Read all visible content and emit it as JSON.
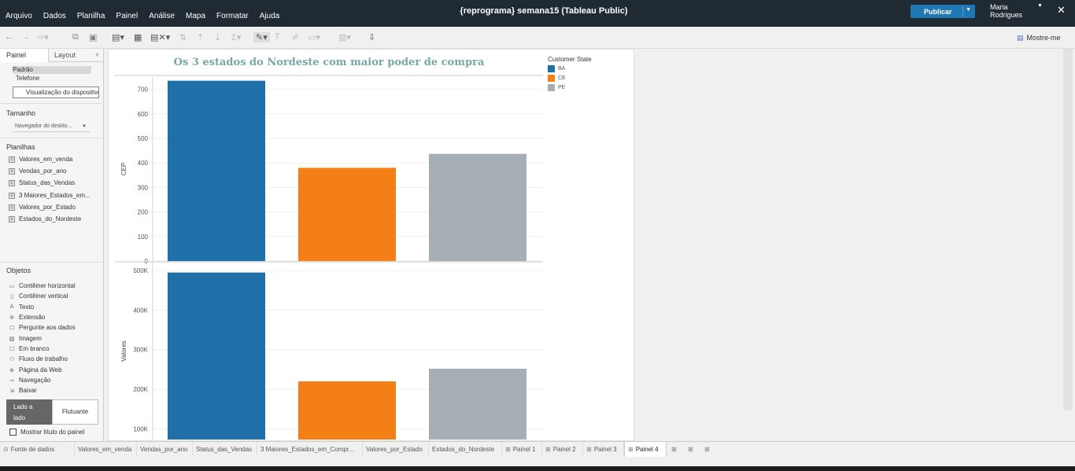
{
  "menu": [
    "Arquivo",
    "Dados",
    "Planilha",
    "Painel",
    "Análise",
    "Mapa",
    "Formatar",
    "Ajuda"
  ],
  "window_title": "{reprograma} semana15 (Tableau Public)",
  "publish_label": "Publicar",
  "user_name": "Maria Rodrigues",
  "toolbar": {
    "show_me": "Mostre-me"
  },
  "left_panel": {
    "tab_painel": "Painel",
    "tab_layout": "Layout",
    "devices": [
      "Padrão",
      "Telefone"
    ],
    "preview_button": "Visualização do dispositivo",
    "size_title": "Tamanho",
    "size_value": "Navegador do deskto...",
    "sheets_title": "Planilhas",
    "sheets": [
      "Valores_em_venda",
      "Vendas_por_ano",
      "Status_das_Vendas",
      "3 Maiores_Estados_em...",
      "Valores_por_Estado",
      "Estados_do_Nordeste"
    ],
    "objects_title": "Objetos",
    "objects": [
      {
        "label": "Contêiner horizontal",
        "icon": "horizontal-container-icon"
      },
      {
        "label": "Contêiner vertical",
        "icon": "vertical-container-icon"
      },
      {
        "label": "Texto",
        "icon": "text-icon"
      },
      {
        "label": "Extensão",
        "icon": "extension-icon"
      },
      {
        "label": "Pergunte aos dados",
        "icon": "ask-data-icon"
      },
      {
        "label": "Imagem",
        "icon": "image-icon"
      },
      {
        "label": "Em branco",
        "icon": "blank-icon"
      },
      {
        "label": "Fluxo de trabalho",
        "icon": "workflow-icon"
      },
      {
        "label": "Página da Web",
        "icon": "web-page-icon"
      },
      {
        "label": "Navegação",
        "icon": "navigation-icon"
      },
      {
        "label": "Baixar",
        "icon": "download-icon"
      }
    ],
    "btn_lado": "Lado a lado",
    "btn_flutuante": "Flutuante",
    "show_title_label": "Mostrar título do painel"
  },
  "bottom_tabs": [
    {
      "label": "Fonte de dados",
      "kind": "datasource"
    },
    {
      "label": "Valores_em_venda",
      "kind": "sheet"
    },
    {
      "label": "Vendas_por_ano",
      "kind": "sheet"
    },
    {
      "label": "Status_das_Vendas",
      "kind": "sheet"
    },
    {
      "label": "3 Maiores_Estados_em_Compr...",
      "kind": "sheet"
    },
    {
      "label": "Valores_por_Estado",
      "kind": "sheet"
    },
    {
      "label": "Estados_do_Nordeste",
      "kind": "sheet"
    },
    {
      "label": "Painel 1",
      "kind": "dashboard"
    },
    {
      "label": "Painel 2",
      "kind": "dashboard"
    },
    {
      "label": "Painel 3",
      "kind": "dashboard"
    },
    {
      "label": "Painel 4",
      "kind": "dashboard",
      "active": true
    }
  ],
  "colors": {
    "BA": "#1f6fa8",
    "CE": "#f57f17",
    "PE": "#a6aeb6",
    "title": "#76a9a0"
  },
  "chart_data": {
    "type": "bar",
    "title": "Os 3 estados do Nordeste com maior poder de compra",
    "legend_title": "Customer State",
    "legend_position": "top-right",
    "categories": [
      "BA",
      "CE",
      "PE"
    ],
    "panels": [
      {
        "ylabel": "CEP",
        "ylim": [
          0,
          750
        ],
        "ticks": [
          0,
          100,
          200,
          300,
          400,
          500,
          600,
          700
        ],
        "tick_labels": [
          "0",
          "100",
          "200",
          "300",
          "400",
          "500",
          "600",
          "700"
        ],
        "values": [
          735,
          380,
          437
        ]
      },
      {
        "ylabel": "Valores",
        "ylim": [
          73000,
          520000
        ],
        "ticks": [
          100000,
          200000,
          300000,
          400000,
          500000
        ],
        "tick_labels": [
          "100K",
          "200K",
          "300K",
          "400K",
          "500K"
        ],
        "values": [
          495000,
          220000,
          252000
        ]
      }
    ]
  }
}
